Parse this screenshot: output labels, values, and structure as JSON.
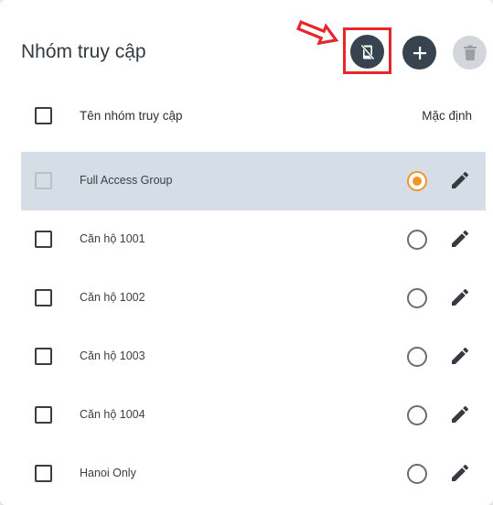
{
  "header": {
    "title": "Nhóm truy cập"
  },
  "toolbar": {
    "highlighted_button_icon": "no-phone-icon",
    "add_button_icon": "plus-icon",
    "delete_button_icon": "trash-icon",
    "annotation_color": "#e5262b",
    "button_color": "#37434f"
  },
  "table": {
    "columns": {
      "name": "Tên nhóm truy cập",
      "default": "Mặc định"
    },
    "rows": [
      {
        "name": "Full Access Group",
        "default": true,
        "selected": true
      },
      {
        "name": "Căn hộ 1001",
        "default": false,
        "selected": false
      },
      {
        "name": "Căn hộ 1002",
        "default": false,
        "selected": false
      },
      {
        "name": "Căn hộ 1003",
        "default": false,
        "selected": false
      },
      {
        "name": "Căn hộ 1004",
        "default": false,
        "selected": false
      },
      {
        "name": "Hanoi Only",
        "default": false,
        "selected": false
      }
    ],
    "radio_on_color": "#f0962a",
    "selected_row_color": "#d5dde6"
  }
}
